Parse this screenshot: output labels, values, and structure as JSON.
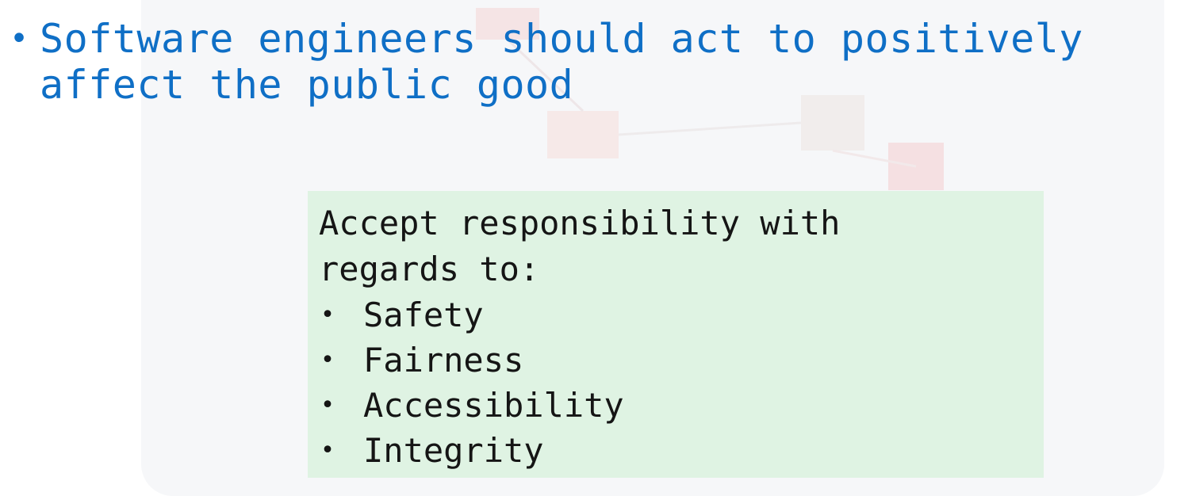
{
  "slide": {
    "bullet_text": "Software engineers should act to positively affect the public good",
    "bullet_glyph": "•"
  },
  "callout": {
    "heading": "Accept responsibility with regards to:",
    "items": [
      {
        "label": "Safety"
      },
      {
        "label": "Fairness"
      },
      {
        "label": "Accessibility"
      },
      {
        "label": "Integrity"
      }
    ],
    "background_color": "#dff3e3"
  },
  "colors": {
    "bullet_text": "#0f6fc6",
    "callout_text": "#151515"
  }
}
